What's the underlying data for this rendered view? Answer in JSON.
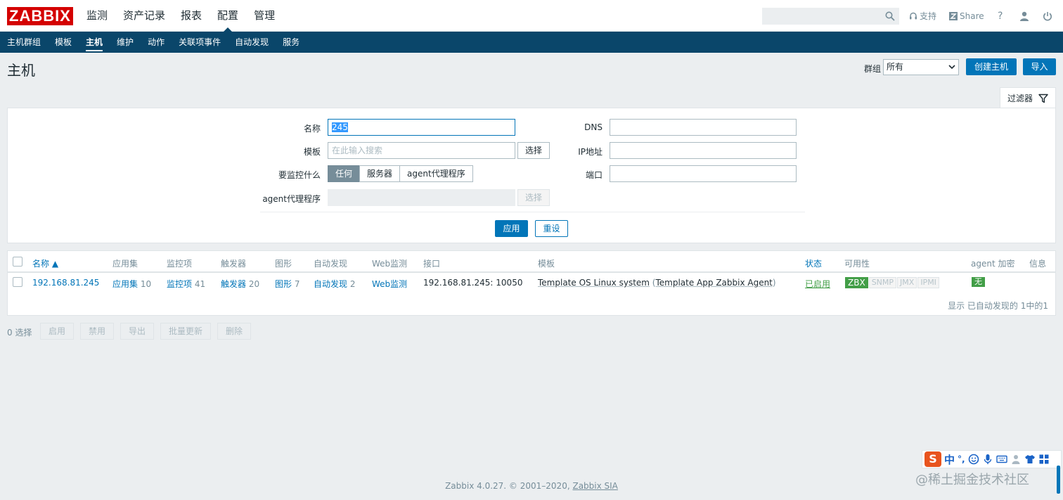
{
  "header": {
    "logo": "ZABBIX",
    "nav": [
      "监测",
      "资产记录",
      "报表",
      "配置",
      "管理"
    ],
    "active_nav": "配置",
    "search_placeholder": "",
    "support": "支持",
    "share": "Share",
    "help": "?"
  },
  "subnav": [
    "主机群组",
    "模板",
    "主机",
    "维护",
    "动作",
    "关联项事件",
    "自动发现",
    "服务"
  ],
  "page": {
    "title": "主机",
    "group_label": "群组",
    "group_value": "所有",
    "create_button": "创建主机",
    "import_button": "导入",
    "filter_tab": "过滤器"
  },
  "filter": {
    "name_label": "名称",
    "name_value": "245",
    "template_label": "模板",
    "template_placeholder": "在此输入搜索",
    "select_button": "选择",
    "monitored_by_label": "要监控什么",
    "monitored_by_options": [
      "任何",
      "服务器",
      "agent代理程序"
    ],
    "proxy_label": "agent代理程序",
    "proxy_select_button": "选择",
    "dns_label": "DNS",
    "ip_label": "IP地址",
    "port_label": "端口",
    "apply_button": "应用",
    "reset_button": "重设"
  },
  "table": {
    "headers": {
      "name": "名称 ▲",
      "applications": "应用集",
      "items": "监控项",
      "triggers": "触发器",
      "graphs": "图形",
      "discovery": "自动发现",
      "web": "Web监测",
      "interface": "接口",
      "templates": "模板",
      "status": "状态",
      "availability": "可用性",
      "encryption": "agent 加密",
      "info": "信息"
    },
    "row": {
      "name": "192.168.81.245",
      "applications_label": "应用集",
      "applications_count": "10",
      "items_label": "监控项",
      "items_count": "41",
      "triggers_label": "触发器",
      "triggers_count": "20",
      "graphs_label": "图形",
      "graphs_count": "7",
      "discovery_label": "自动发现",
      "discovery_count": "2",
      "web_label": "Web监测",
      "interface": "192.168.81.245: 10050",
      "template_main": "Template OS Linux system",
      "template_open": " (",
      "template_sub": "Template App Zabbix Agent",
      "template_close": ")",
      "status": "已启用",
      "availability": [
        "ZBX",
        "SNMP",
        "JMX",
        "IPMI"
      ],
      "encryption": "无"
    },
    "pager": "显示 已自动发现的 1中的1"
  },
  "mass_actions": {
    "selected": "0 选择",
    "buttons": [
      "启用",
      "禁用",
      "导出",
      "批量更新",
      "删除"
    ]
  },
  "footer": {
    "text": "Zabbix 4.0.27. © 2001–2020, ",
    "company": "Zabbix SIA"
  },
  "ime": {
    "logo": "S",
    "lang": "中",
    "punct": "°,"
  },
  "watermark": "@稀土掘金技术社区"
}
